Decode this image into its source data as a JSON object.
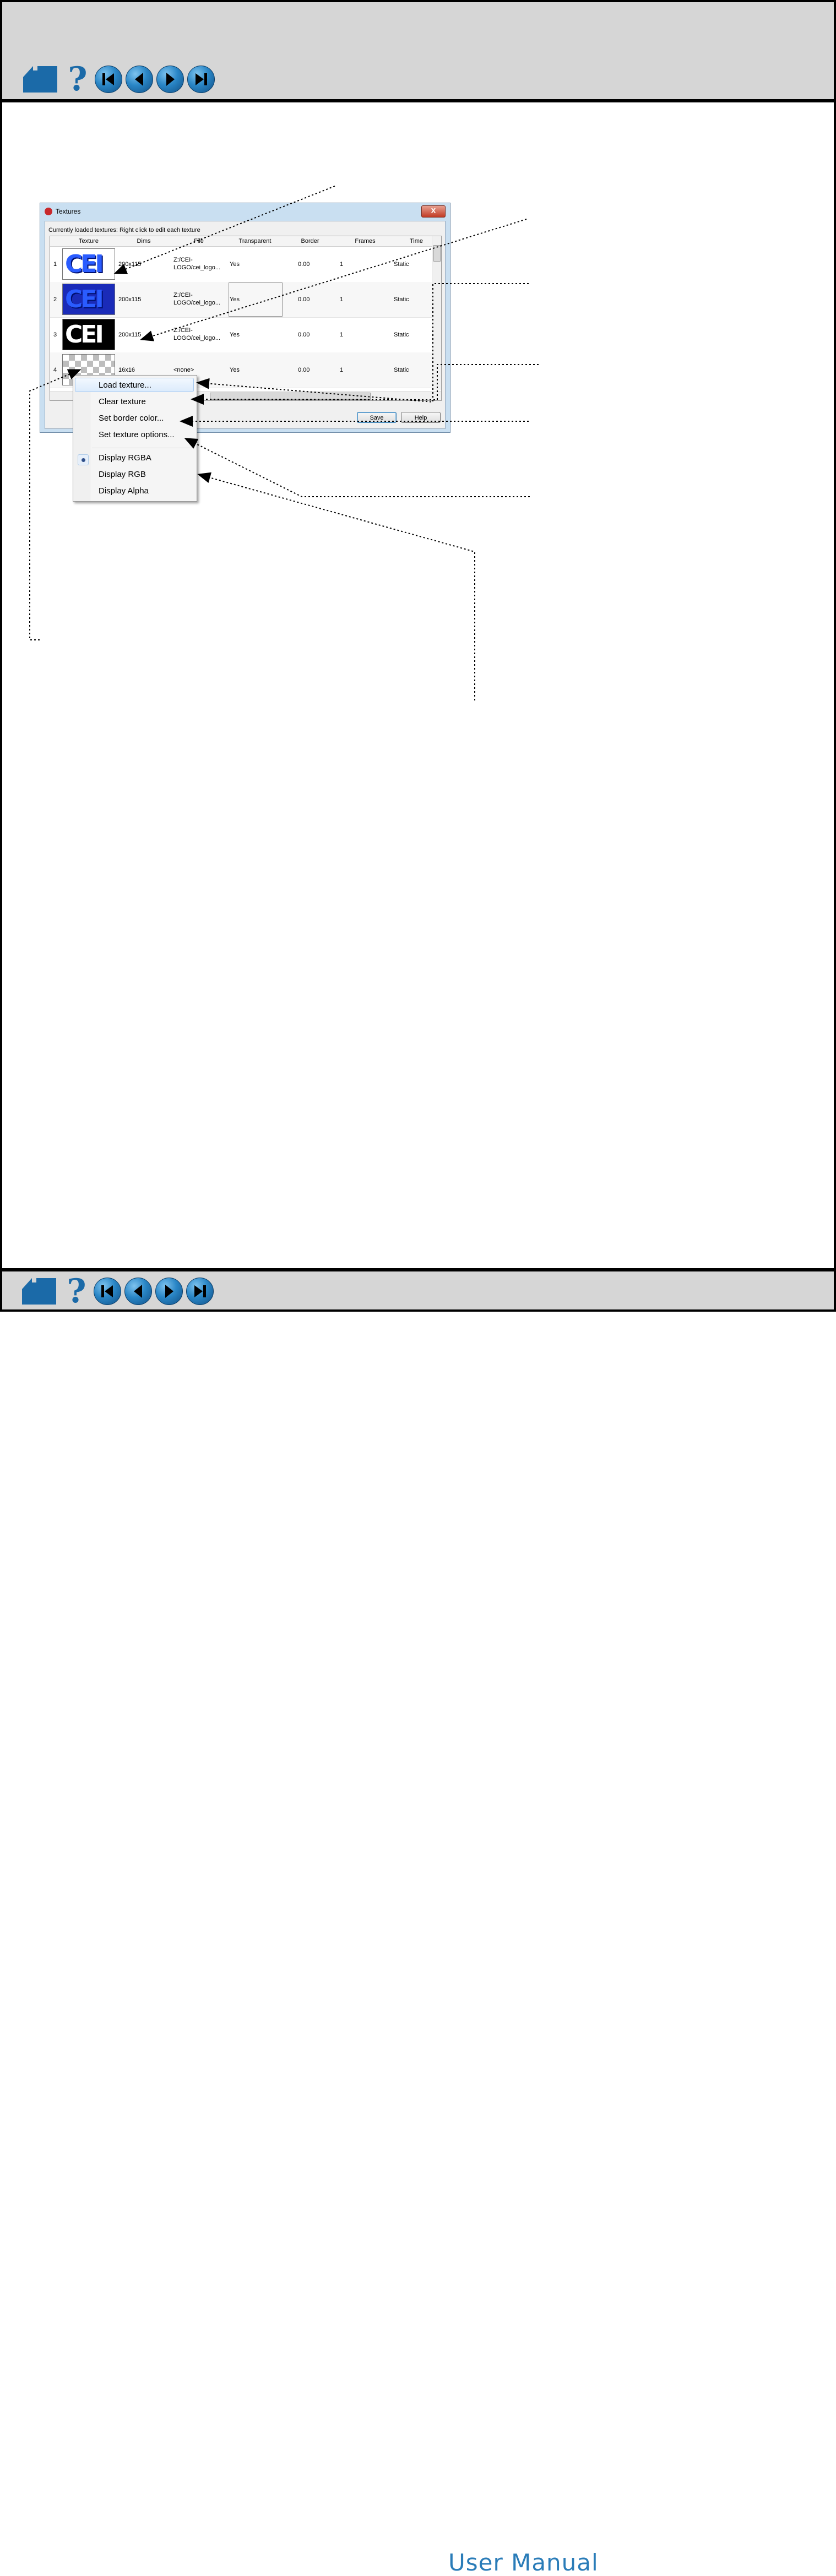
{
  "nav": {
    "icons": [
      "home-icon",
      "help-icon",
      "first-page-icon",
      "previous-page-icon",
      "next-page-icon",
      "last-page-icon"
    ],
    "help_glyph": "?",
    "footer_title": "User Manual"
  },
  "dialog": {
    "title": "Textures",
    "close_glyph": "X",
    "caption": "Currently loaded textures: Right click to edit each texture",
    "columns": [
      "Texture",
      "Dims",
      "File",
      "Transparent",
      "Border",
      "Frames",
      "Time"
    ],
    "rows": [
      {
        "num": "1",
        "thumb_text": "CEI",
        "dims": "200x115",
        "file_1": "Z:/CEI-",
        "file_2": "LOGO/cei_logo...",
        "transparent": "Yes",
        "border": "0.00",
        "frames": "1",
        "time": "Static"
      },
      {
        "num": "2",
        "thumb_text": "CEI",
        "dims": "200x115",
        "file_1": "Z:/CEI-",
        "file_2": "LOGO/cei_logo...",
        "transparent": "Yes",
        "border": "0.00",
        "frames": "1",
        "time": "Static"
      },
      {
        "num": "3",
        "thumb_text": "CEI",
        "dims": "200x115",
        "file_1": "Z:/CEI-",
        "file_2": "LOGO/cei_logo...",
        "transparent": "Yes",
        "border": "0.00",
        "frames": "1",
        "time": "Static"
      },
      {
        "num": "4",
        "thumb_text": "",
        "dims": "16x16",
        "file_1": "<none>",
        "file_2": "",
        "transparent": "Yes",
        "border": "0.00",
        "frames": "1",
        "time": "Static"
      }
    ],
    "save_label": "Save",
    "help_label": "Help"
  },
  "context_menu": {
    "load_texture": "Load texture...",
    "clear_texture": "Clear texture",
    "set_border_color": "Set border color...",
    "set_texture_options": "Set texture options...",
    "display_rgba": "Display RGBA",
    "display_rgb": "Display RGB",
    "display_alpha": "Display Alpha",
    "selected_display": "Display RGBA"
  },
  "colors": {
    "frame_bg": "#d6d6d6",
    "nav_blue": "#2a86c6",
    "footer_title": "#2a7cb8",
    "dialog_frame": "#c9dff1"
  }
}
